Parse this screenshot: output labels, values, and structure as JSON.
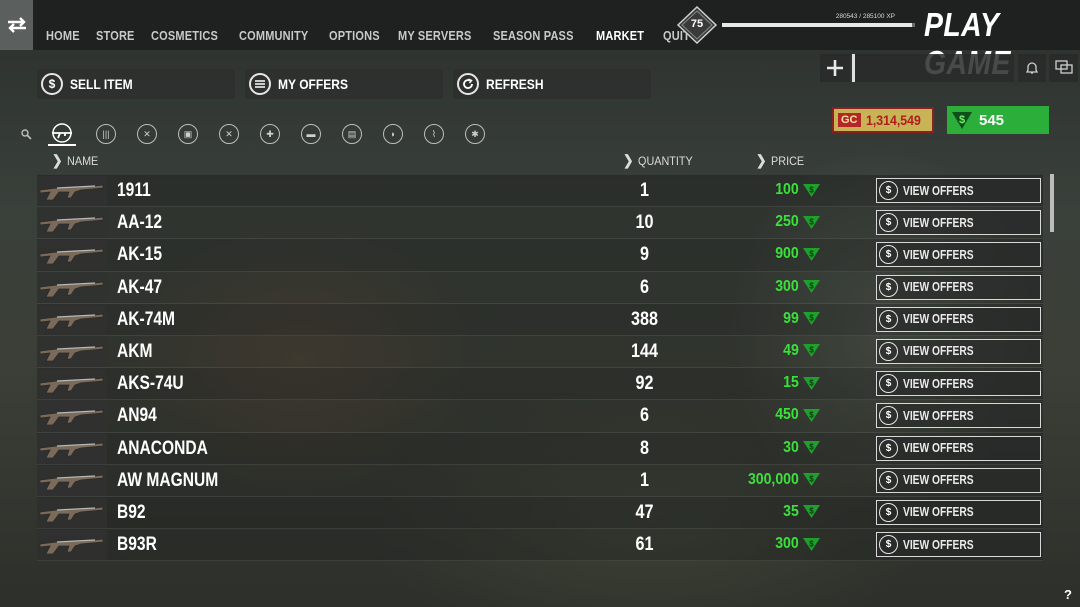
{
  "nav": {
    "items": [
      "HOME",
      "STORE",
      "COSMETICS",
      "COMMUNITY",
      "OPTIONS",
      "MY SERVERS",
      "SEASON PASS",
      "MARKET",
      "QUIT"
    ],
    "active": "MARKET"
  },
  "player": {
    "level": "75",
    "xp_text": "280543 / 285100 XP",
    "xp_progress": 0.984
  },
  "play_label": "PLAY GAME",
  "actions": {
    "sell": "SELL ITEM",
    "offers": "MY OFFERS",
    "refresh": "REFRESH"
  },
  "currency": {
    "gc_tag": "GC",
    "gc_value": "1,314,549",
    "cash_value": "545"
  },
  "categories": [
    "search-icon",
    "rifle-icon",
    "ammo-icon",
    "food-icon",
    "backpack-icon",
    "tools-icon",
    "medical-icon",
    "vehicle-icon",
    "clothing-icon",
    "helmet-icon",
    "fishing-icon",
    "misc-icon"
  ],
  "table": {
    "headers": {
      "name": "NAME",
      "quantity": "QUANTITY",
      "price": "PRICE"
    },
    "button_label": "VIEW OFFERS",
    "rows": [
      {
        "name": "1911",
        "quantity": "1",
        "price": "100"
      },
      {
        "name": "AA-12",
        "quantity": "10",
        "price": "250"
      },
      {
        "name": "AK-15",
        "quantity": "9",
        "price": "900"
      },
      {
        "name": "AK-47",
        "quantity": "6",
        "price": "300"
      },
      {
        "name": "AK-74M",
        "quantity": "388",
        "price": "99"
      },
      {
        "name": "AKM",
        "quantity": "144",
        "price": "49"
      },
      {
        "name": "AKS-74U",
        "quantity": "92",
        "price": "15"
      },
      {
        "name": "AN94",
        "quantity": "6",
        "price": "450"
      },
      {
        "name": "ANACONDA",
        "quantity": "8",
        "price": "30"
      },
      {
        "name": "AW MAGNUM",
        "quantity": "1",
        "price": "300,000"
      },
      {
        "name": "B92",
        "quantity": "47",
        "price": "35"
      },
      {
        "name": "B93R",
        "quantity": "61",
        "price": "300"
      }
    ]
  },
  "help": "?",
  "colors": {
    "price_green": "#3ce03c",
    "cash_green": "#2cae3a",
    "gc_gold": "#c8b357",
    "gc_red": "#b52626"
  }
}
